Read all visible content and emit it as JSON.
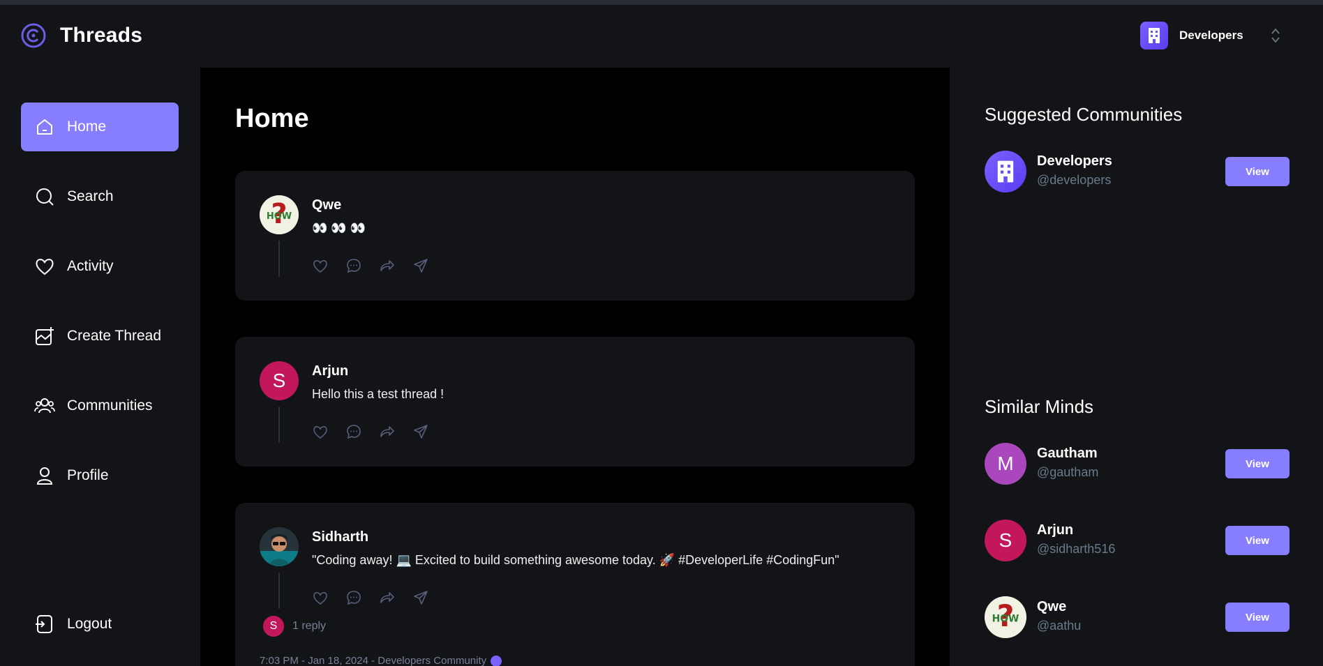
{
  "app": {
    "name": "Threads"
  },
  "org_switcher": {
    "name": "Developers"
  },
  "sidebar": {
    "items": [
      {
        "label": "Home",
        "icon": "home-icon",
        "active": true
      },
      {
        "label": "Search",
        "icon": "search-icon"
      },
      {
        "label": "Activity",
        "icon": "heart-icon"
      },
      {
        "label": "Create Thread",
        "icon": "create-thread-icon"
      },
      {
        "label": "Communities",
        "icon": "communities-icon"
      },
      {
        "label": "Profile",
        "icon": "profile-icon"
      }
    ],
    "logout_label": "Logout"
  },
  "main": {
    "title": "Home",
    "threads": [
      {
        "author": "Qwe",
        "content": "👀 👀 👀",
        "avatar": "how-question-image"
      },
      {
        "author": "Arjun",
        "content": "Hello this a test thread !",
        "avatar_letter": "S"
      },
      {
        "author": "Sidharth",
        "content": "\"Coding away! 💻 Excited to build something awesome today. 🚀 #DeveloperLife #CodingFun\"",
        "avatar": "photo-person",
        "reply_avatar_letter": "S",
        "replies": "1 reply",
        "meta": "7:03 PM - Jan 18, 2024 - Developers Community"
      }
    ]
  },
  "right": {
    "suggested_title": "Suggested Communities",
    "communities": [
      {
        "name": "Developers",
        "handle": "@developers",
        "button": "View"
      }
    ],
    "similar_title": "Similar Minds",
    "users": [
      {
        "name": "Gautham",
        "handle": "@gautham",
        "letter": "M",
        "color": "#ab47bc",
        "button": "View"
      },
      {
        "name": "Arjun",
        "handle": "@sidharth516",
        "letter": "S",
        "color": "#c2185b",
        "button": "View"
      },
      {
        "name": "Qwe",
        "handle": "@aathu",
        "button": "View"
      }
    ]
  },
  "colors": {
    "accent": "#877eff",
    "background": "#121417",
    "feed": "#000000",
    "muted": "#697c89"
  }
}
